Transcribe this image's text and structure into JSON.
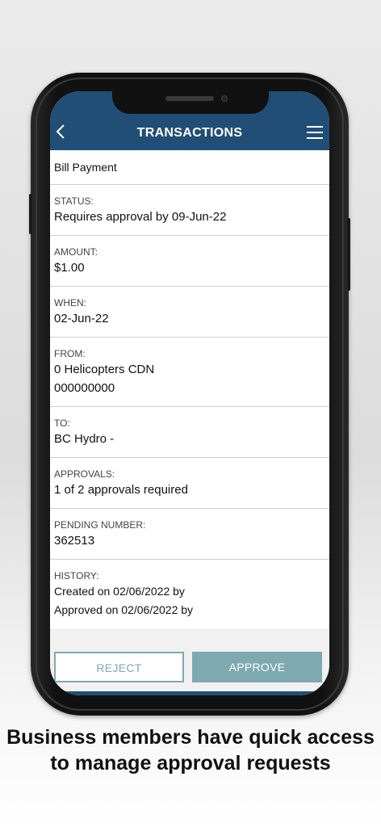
{
  "header": {
    "title": "TRANSACTIONS"
  },
  "transaction": {
    "type": "Bill Payment",
    "status_label": "STATUS:",
    "status_value": "Requires approval by 09-Jun-22",
    "amount_label": "AMOUNT:",
    "amount_value": "$1.00",
    "when_label": "WHEN:",
    "when_value": "02-Jun-22",
    "from_label": "FROM:",
    "from_value_1": "0 Helicopters CDN",
    "from_value_2": "000000000",
    "to_label": "TO:",
    "to_value": "BC Hydro -",
    "approvals_label": "APPROVALS:",
    "approvals_value": "1 of 2 approvals required",
    "pending_label": "PENDING NUMBER:",
    "pending_value": "362513",
    "history_label": "HISTORY:",
    "history_1": "Created on 02/06/2022 by",
    "history_2": "Approved on 02/06/2022 by"
  },
  "actions": {
    "reject": "REJECT",
    "approve": "APPROVE"
  },
  "caption": {
    "line1": "Business members have quick access",
    "line2": "to manage approval requests"
  },
  "colors": {
    "header": "#214e76",
    "accent": "#7ea9b1"
  }
}
